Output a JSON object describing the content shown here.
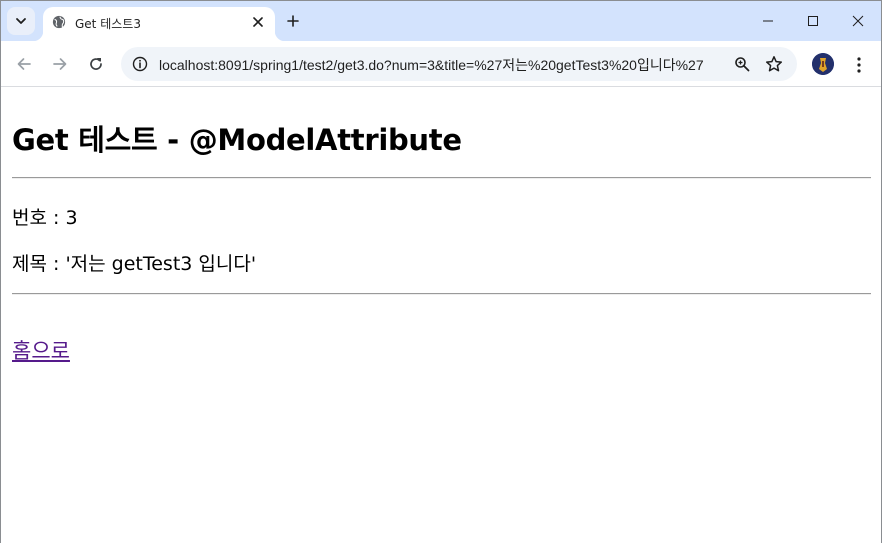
{
  "browser": {
    "tab": {
      "title": "Get 테스트3",
      "favicon": "globe-icon"
    },
    "controls": {
      "tab_search": "chevron-down-icon",
      "new_tab": "plus-icon",
      "minimize": "minimize-icon",
      "maximize": "maximize-icon",
      "close": "close-icon"
    },
    "toolbar": {
      "url": "localhost:8091/spring1/test2/get3.do?num=3&title=%27저는%20getTest3%20입니다%27",
      "back": "arrow-left-icon",
      "forward": "arrow-right-icon",
      "reload": "reload-icon",
      "site_info": "info-icon",
      "zoom": "zoom-icon",
      "bookmark": "star-icon",
      "menu": "kebab-menu-icon"
    }
  },
  "page": {
    "title": "Get 테스트 - @ModelAttribute",
    "num_line": "번호 : 3",
    "title_line": "제목 : '저는 getTest3 입니다'",
    "home_link": "홈으로"
  },
  "colors": {
    "tabstrip": "#d3e3fd",
    "omnibox": "#f0f4f9",
    "visited_link": "#551a8b"
  }
}
